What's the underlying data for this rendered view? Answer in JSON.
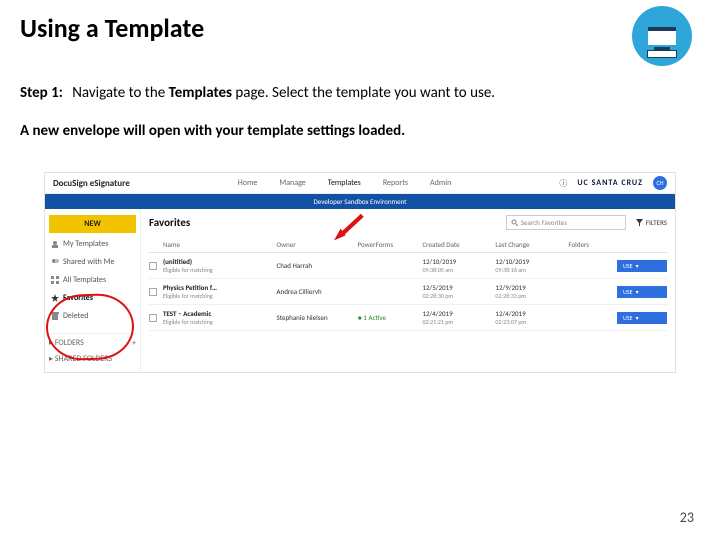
{
  "title": "Using a Template",
  "step": {
    "label": "Step 1:",
    "pre": "Navigate to the ",
    "bold": "Templates",
    "post": " page. Select the template you want to use."
  },
  "result_line": "A new envelope will open with your template settings loaded.",
  "page_number": "23",
  "app": {
    "brand": "DocuSign eSignature",
    "nav": {
      "home": "Home",
      "manage": "Manage",
      "templates": "Templates",
      "reports": "Reports",
      "admin": "Admin"
    },
    "ucsc": "UC SANTA CRUZ",
    "avatar_initials": "CH",
    "banner": "Developer Sandbox Environment"
  },
  "sidebar": {
    "new": "NEW",
    "items": {
      "my": "My Templates",
      "shared": "Shared with Me",
      "all": "All Templates",
      "fav": "Favorites",
      "del": "Deleted"
    },
    "folders": "FOLDERS",
    "plus": "+",
    "shared_folders": "SHARED FOLDERS"
  },
  "main": {
    "heading": "Favorites",
    "search_placeholder": "Search Favorites",
    "filters": "FILTERS",
    "columns": {
      "name": "Name",
      "owner": "Owner",
      "powerforms": "PowerForms",
      "created": "Created Date",
      "last": "Last Change",
      "folders": "Folders"
    },
    "use": "USE"
  },
  "rows": [
    {
      "name": "(unititled)",
      "sub": "Eligible for matching",
      "owner": "Chad Harrah",
      "pf": "",
      "created_d": "12/10/2019",
      "created_t": "09:38:05 am",
      "last_d": "12/10/2019",
      "last_t": "09:38:16 am"
    },
    {
      "name": "Physics Petition f…",
      "sub": "Eligible for matching",
      "owner": "Andrea Cilliervh",
      "pf": "",
      "created_d": "12/5/2019",
      "created_t": "02:28:30 pm",
      "last_d": "12/9/2019",
      "last_t": "02:28:33 pm"
    },
    {
      "name": "TEST – Academic",
      "sub": "Eligible for matching",
      "owner": "Stephanie Nielsen",
      "pf": "1 Active",
      "created_d": "12/4/2019",
      "created_t": "02:21:21 pm",
      "last_d": "12/4/2019",
      "last_t": "02:23:07 pm"
    }
  ]
}
